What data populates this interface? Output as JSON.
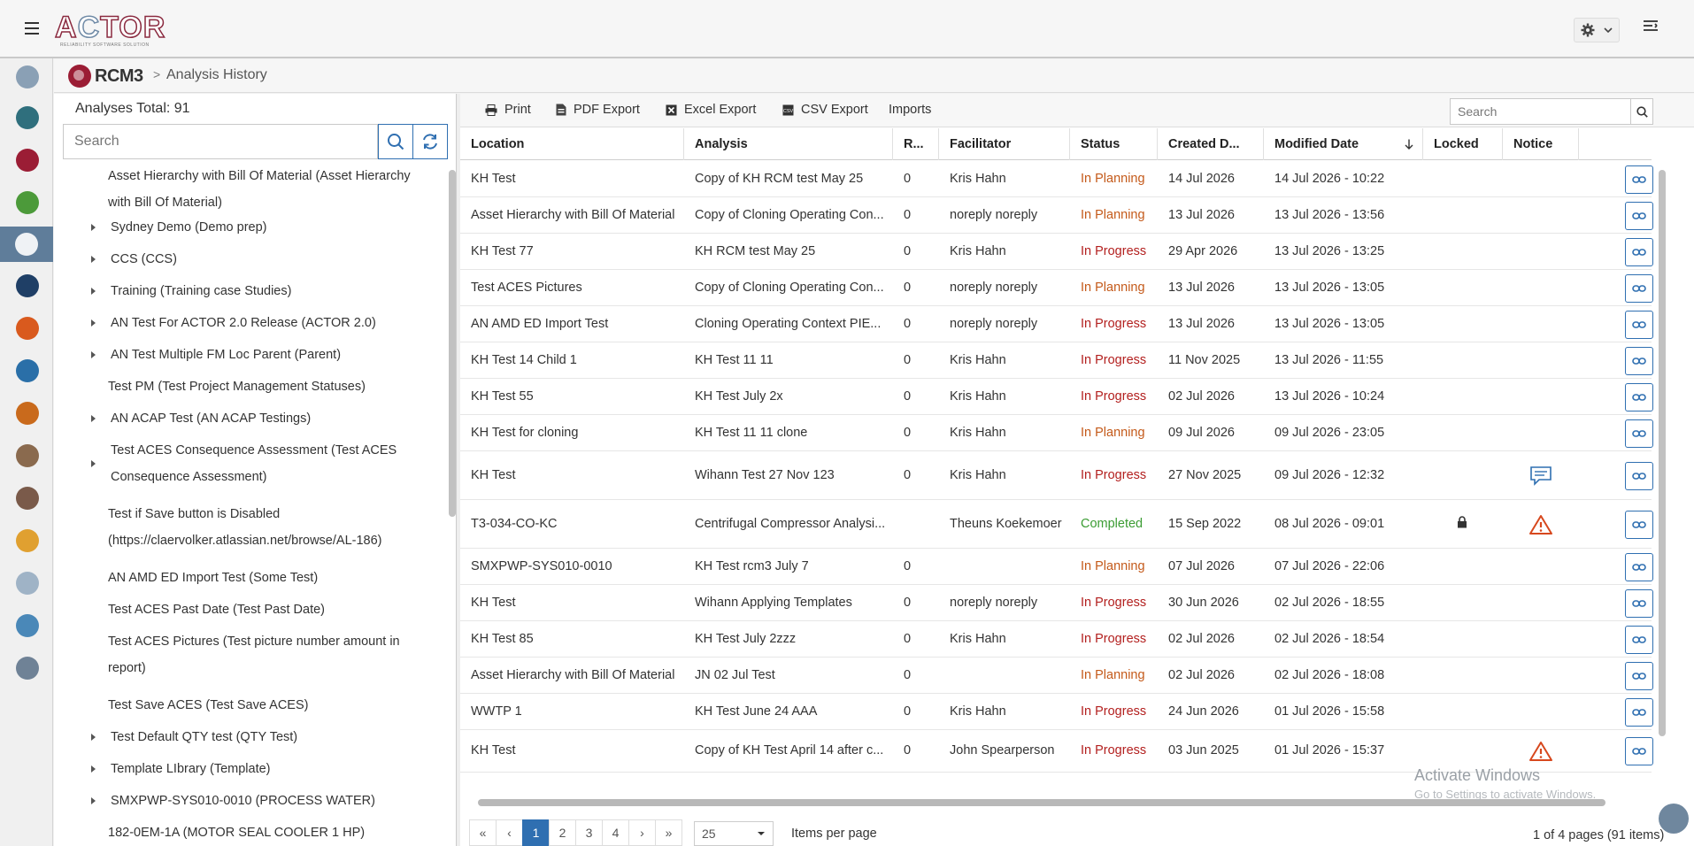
{
  "app": {
    "logo_text": "ACTOR",
    "logo_tagline": "RELIABILITY SOFTWARE SOLUTION",
    "module_logo_text": "RCM3"
  },
  "breadcrumb": {
    "separator": ">",
    "current": "Analysis History"
  },
  "left_panel": {
    "total_label": "Analyses Total: 91",
    "search_placeholder": "Search",
    "tree_items": [
      {
        "label": "Asset Hierarchy with Bill Of Material (Asset Hierarchy with Bill Of Material)",
        "line1": "Asset Hierarchy with Bill Of Material (Asset Hierarchy",
        "line2": "with Bill Of Material)",
        "expandable": false
      },
      {
        "label": "Sydney Demo (Demo prep)",
        "expandable": true
      },
      {
        "label": "CCS (CCS)",
        "expandable": true
      },
      {
        "label": "Training (Training case Studies)",
        "expandable": true
      },
      {
        "label": "AN Test For ACTOR 2.0 Release (ACTOR 2.0)",
        "expandable": true
      },
      {
        "label": "AN Test Multiple FM Loc Parent (Parent)",
        "expandable": true
      },
      {
        "label": "Test PM (Test Project Management Statuses)",
        "expandable": false
      },
      {
        "label": "AN ACAP Test (AN ACAP Testings)",
        "expandable": true
      },
      {
        "label": "Test ACES Consequence Assessment (Test ACES Consequence Assessment)",
        "line1": "Test ACES Consequence Assessment (Test ACES",
        "line2": "Consequence Assessment)",
        "expandable": true
      },
      {
        "label": "Test if Save button is Disabled (https://claervolker.atlassian.net/browse/AL-186)",
        "line1": "Test if Save button is Disabled",
        "line2": "(https://claervolker.atlassian.net/browse/AL-186)",
        "expandable": false
      },
      {
        "label": "AN AMD ED Import Test (Some Test)",
        "expandable": false
      },
      {
        "label": "Test ACES Past Date (Test Past Date)",
        "expandable": false
      },
      {
        "label": "Test ACES Pictures (Test picture number amount in report)",
        "line1": "Test ACES Pictures (Test picture number amount in",
        "line2": "report)",
        "expandable": false
      },
      {
        "label": "Test Save ACES (Test Save ACES)",
        "expandable": false
      },
      {
        "label": "Test Default QTY test (QTY Test)",
        "expandable": true
      },
      {
        "label": "Template LIbrary (Template)",
        "expandable": true
      },
      {
        "label": "SMXPWP-SYS010-0010 (PROCESS WATER)",
        "expandable": true
      },
      {
        "label": "182-0EM-1A (MOTOR SEAL COOLER 1 HP)",
        "expandable": false
      }
    ]
  },
  "toolbar": {
    "print": "Print",
    "pdf_export": "PDF Export",
    "excel_export": "Excel Export",
    "csv_export": "CSV Export",
    "imports": "Imports",
    "search_placeholder": "Search"
  },
  "table": {
    "headers": {
      "location": "Location",
      "analysis": "Analysis",
      "r": "R...",
      "facilitator": "Facilitator",
      "status": "Status",
      "created": "Created D...",
      "modified": "Modified Date",
      "locked": "Locked",
      "notice": "Notice"
    },
    "rows": [
      {
        "location": "KH Test",
        "analysis": "Copy of KH RCM test May 25",
        "r": "0",
        "facilitator": "Kris Hahn",
        "status": "In Planning",
        "created": "14 Jul 2026",
        "modified": "14 Jul 2026 - 10:22",
        "locked": false,
        "notice": ""
      },
      {
        "location": "Asset Hierarchy with Bill Of Material",
        "analysis": "Copy of Cloning Operating Con...",
        "r": "0",
        "facilitator": "noreply noreply",
        "status": "In Planning",
        "created": "13 Jul 2026",
        "modified": "13 Jul 2026 - 13:56",
        "locked": false,
        "notice": ""
      },
      {
        "location": "KH Test 77",
        "analysis": "KH RCM test May 25",
        "r": "0",
        "facilitator": "Kris Hahn",
        "status": "In Progress",
        "created": "29 Apr 2026",
        "modified": "13 Jul 2026 - 13:25",
        "locked": false,
        "notice": ""
      },
      {
        "location": "Test ACES Pictures",
        "analysis": "Copy of Cloning Operating Con...",
        "r": "0",
        "facilitator": "noreply noreply",
        "status": "In Planning",
        "created": "13 Jul 2026",
        "modified": "13 Jul 2026 - 13:05",
        "locked": false,
        "notice": ""
      },
      {
        "location": "AN AMD ED Import Test",
        "analysis": "Cloning Operating Context PIE...",
        "r": "0",
        "facilitator": "noreply noreply",
        "status": "In Progress",
        "created": "13 Jul 2026",
        "modified": "13 Jul 2026 - 13:05",
        "locked": false,
        "notice": ""
      },
      {
        "location": "KH Test 14 Child 1",
        "analysis": "KH Test 11 11",
        "r": "0",
        "facilitator": "Kris Hahn",
        "status": "In Progress",
        "created": "11 Nov 2025",
        "modified": "13 Jul 2026 - 11:55",
        "locked": false,
        "notice": ""
      },
      {
        "location": "KH Test 55",
        "analysis": "KH Test July 2x",
        "r": "0",
        "facilitator": "Kris Hahn",
        "status": "In Progress",
        "created": "02 Jul 2026",
        "modified": "13 Jul 2026 - 10:24",
        "locked": false,
        "notice": ""
      },
      {
        "location": "KH Test for cloning",
        "analysis": "KH Test 11 11 clone",
        "r": "0",
        "facilitator": "Kris Hahn",
        "status": "In Planning",
        "created": "09 Jul 2026",
        "modified": "09 Jul 2026 - 23:05",
        "locked": false,
        "notice": ""
      },
      {
        "location": "KH Test",
        "analysis": "Wihann Test 27 Nov 123",
        "r": "0",
        "facilitator": "Kris Hahn",
        "status": "In Progress",
        "created": "27 Nov 2025",
        "modified": "09 Jul 2026 - 12:32",
        "locked": false,
        "notice": "comment"
      },
      {
        "location": "T3-034-CO-KC",
        "analysis": "Centrifugal Compressor Analysi...",
        "r": "",
        "facilitator": "Theuns Koekemoer",
        "status": "Completed",
        "created": "15 Sep 2022",
        "modified": "08 Jul 2026 - 09:01",
        "locked": true,
        "notice": "warning"
      },
      {
        "location": "SMXPWP-SYS010-0010",
        "analysis": "KH Test rcm3 July 7",
        "r": "0",
        "facilitator": "",
        "status": "In Planning",
        "created": "07 Jul 2026",
        "modified": "07 Jul 2026 - 22:06",
        "locked": false,
        "notice": ""
      },
      {
        "location": "KH Test",
        "analysis": "Wihann Applying Templates",
        "r": "0",
        "facilitator": "noreply noreply",
        "status": "In Progress",
        "created": "30 Jun 2026",
        "modified": "02 Jul 2026 - 18:55",
        "locked": false,
        "notice": ""
      },
      {
        "location": "KH Test 85",
        "analysis": "KH Test July 2zzz",
        "r": "0",
        "facilitator": "Kris Hahn",
        "status": "In Progress",
        "created": "02 Jul 2026",
        "modified": "02 Jul 2026 - 18:54",
        "locked": false,
        "notice": ""
      },
      {
        "location": "Asset Hierarchy with Bill Of Material",
        "analysis": "JN 02 Jul Test",
        "r": "0",
        "facilitator": "",
        "status": "In Planning",
        "created": "02 Jul 2026",
        "modified": "02 Jul 2026 - 18:08",
        "locked": false,
        "notice": ""
      },
      {
        "location": "WWTP 1",
        "analysis": "KH Test June 24 AAA",
        "r": "0",
        "facilitator": "Kris Hahn",
        "status": "In Progress",
        "created": "24 Jun 2026",
        "modified": "01 Jul 2026 - 15:58",
        "locked": false,
        "notice": ""
      },
      {
        "location": "KH Test",
        "analysis": "Copy of KH Test April 14 after c...",
        "r": "0",
        "facilitator": "John Spearperson",
        "status": "In Progress",
        "created": "03 Jun 2025",
        "modified": "01 Jul 2026 - 15:37",
        "locked": false,
        "notice": "warning"
      }
    ]
  },
  "pager": {
    "first": "«",
    "prev": "‹",
    "pages": [
      "1",
      "2",
      "3",
      "4"
    ],
    "current_page": "1",
    "next": "›",
    "last": "»",
    "page_size": "25",
    "items_per_page_label": "Items per page",
    "page_info": "1 of 4 pages (91 items)"
  },
  "os_overlay": {
    "watermark_title": "Activate Windows",
    "watermark_sub": "Go to Settings to activate Windows."
  },
  "colors": {
    "accent_blue": "#2f6fb1",
    "status_in_planning": "#c45a1a",
    "status_in_progress": "#b3201f",
    "status_completed": "#3b9c33",
    "nav_active": "#5f7d9a"
  }
}
